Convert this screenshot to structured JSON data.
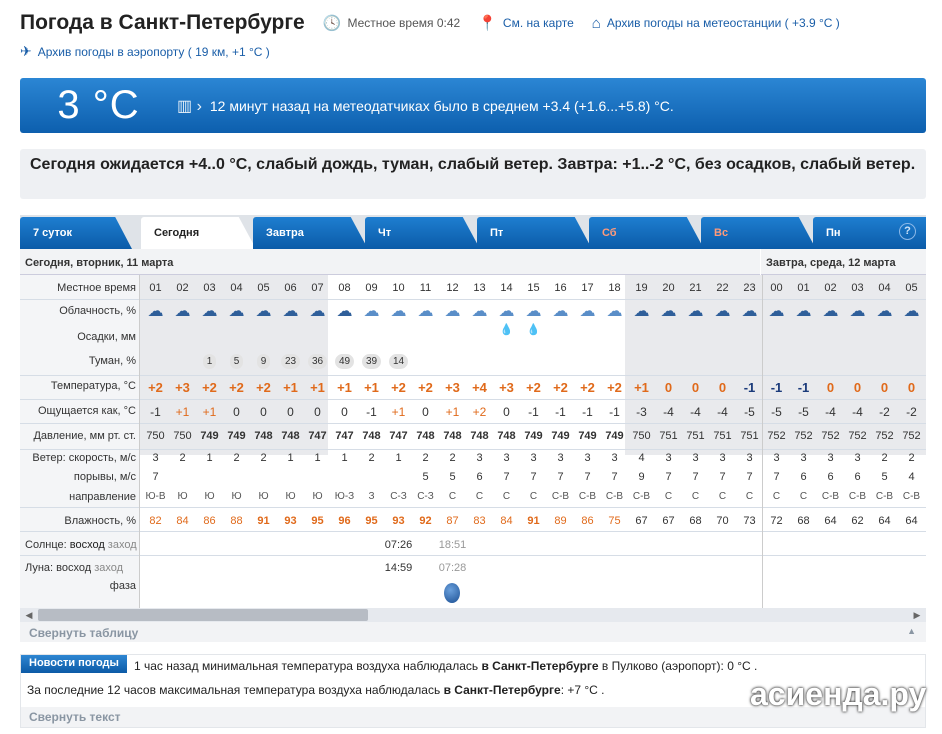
{
  "header": {
    "title": "Погода в Санкт-Петербурге",
    "local_time_label": "Местное время",
    "local_time": "0:42",
    "map_link": "См. на карте",
    "station_link": "Архив погоды на метеостанции",
    "station_temp": "( +3.9 °C )",
    "airport_link": "Архив погоды в аэропорту",
    "airport_info": "( 19 км, +1 °C )"
  },
  "banner": {
    "temp": "3 °C",
    "message": "12 минут назад на метеодатчиках было в среднем +3.4 (+1.6...+5.8) °C."
  },
  "forecast": "Сегодня ожидается +4..0 °C, слабый дождь, туман, слабый ветер. Завтра: +1..-2 °C, без осадков, слабый ветер.",
  "tabs": [
    "7 суток",
    "Сегодня",
    "Завтра",
    "Чт",
    "Пт",
    "Сб",
    "Вс",
    "Пн"
  ],
  "help": "?",
  "days": {
    "today": "Сегодня, вторник, 11 марта",
    "tomorrow": "Завтра, среда, 12 марта"
  },
  "labels": {
    "time": "Местное время",
    "clouds": "Облачность, %",
    "precip": "Осадки, мм",
    "fog": "Туман, %",
    "temp": "Температура, °C",
    "feels": "Ощущается как, °C",
    "pressure": "Давление, мм рт. ст.",
    "wind": "Ветер: скорость, м/с",
    "gusts": "порывы, м/с",
    "dir": "направление",
    "humidity": "Влажность, %",
    "sun_a": "Солнце: ",
    "sun_b": "восход",
    "sun_c": " заход",
    "moon_a": "Луна: ",
    "moon_b": "восход",
    "moon_c": " заход",
    "phase": "фаза"
  },
  "hours": [
    "01",
    "02",
    "03",
    "04",
    "05",
    "06",
    "07",
    "08",
    "09",
    "10",
    "11",
    "12",
    "13",
    "14",
    "15",
    "16",
    "17",
    "18",
    "19",
    "20",
    "21",
    "22",
    "23",
    "00",
    "01",
    "02",
    "03",
    "04",
    "05"
  ],
  "cloud_icons": [
    "☁",
    "☁",
    "☁",
    "☁",
    "☁",
    "☁",
    "☁",
    "☁",
    "☁",
    "☁",
    "☁",
    "☁",
    "☁",
    "☁",
    "☁",
    "☁",
    "☁",
    "☁",
    "☁",
    "☁",
    "☁",
    "☁",
    "☁",
    "☁",
    "☁",
    "☁",
    "☁",
    "☁",
    "☁"
  ],
  "rain_drops": [
    "💧",
    "💧"
  ],
  "fog": [
    "",
    "",
    "1",
    "5",
    "9",
    "23",
    "36",
    "49",
    "39",
    "14",
    "",
    "",
    "",
    "",
    "",
    "",
    "",
    "",
    "",
    "",
    "",
    "",
    "",
    "",
    "",
    "",
    "",
    "",
    ""
  ],
  "temp": [
    "+2",
    "+3",
    "+2",
    "+2",
    "+2",
    "+1",
    "+1",
    "+1",
    "+1",
    "+2",
    "+2",
    "+3",
    "+4",
    "+3",
    "+2",
    "+2",
    "+2",
    "+2",
    "+1",
    "0",
    "0",
    "0",
    "-1",
    "-1",
    "-1",
    "0",
    "0",
    "0",
    "0"
  ],
  "feels": [
    "-1",
    "+1",
    "+1",
    "0",
    "0",
    "0",
    "0",
    "0",
    "-1",
    "+1",
    "0",
    "+1",
    "+2",
    "0",
    "-1",
    "-1",
    "-1",
    "-1",
    "-3",
    "-4",
    "-4",
    "-4",
    "-5",
    "-5",
    "-5",
    "-4",
    "-4",
    "-2",
    "-2"
  ],
  "pressure": [
    "750",
    "750",
    "749",
    "749",
    "748",
    "748",
    "747",
    "747",
    "748",
    "747",
    "748",
    "748",
    "748",
    "748",
    "749",
    "749",
    "749",
    "749",
    "750",
    "751",
    "751",
    "751",
    "751",
    "752",
    "752",
    "752",
    "752",
    "752",
    "752"
  ],
  "wind": [
    "3",
    "2",
    "1",
    "2",
    "2",
    "1",
    "1",
    "1",
    "2",
    "1",
    "2",
    "2",
    "3",
    "3",
    "3",
    "3",
    "3",
    "3",
    "4",
    "3",
    "3",
    "3",
    "3",
    "3",
    "3",
    "3",
    "3",
    "2",
    "2"
  ],
  "gusts": [
    "7",
    "",
    "",
    "",
    "",
    "",
    "",
    "",
    "",
    "",
    "5",
    "5",
    "6",
    "7",
    "7",
    "7",
    "7",
    "7",
    "9",
    "7",
    "7",
    "7",
    "7",
    "7",
    "6",
    "6",
    "6",
    "5",
    "4"
  ],
  "dir": [
    "Ю-В",
    "Ю",
    "Ю",
    "Ю",
    "Ю",
    "Ю",
    "Ю",
    "Ю-З",
    "З",
    "С-З",
    "С-З",
    "С",
    "С",
    "С",
    "С",
    "С-В",
    "С-В",
    "С-В",
    "С-В",
    "С",
    "С",
    "С",
    "С",
    "С",
    "С",
    "С-В",
    "С-В",
    "С-В",
    "С-В"
  ],
  "humidity": [
    "82",
    "84",
    "86",
    "88",
    "91",
    "93",
    "95",
    "96",
    "95",
    "93",
    "92",
    "87",
    "83",
    "84",
    "91",
    "89",
    "86",
    "75",
    "67",
    "67",
    "68",
    "70",
    "73",
    "72",
    "68",
    "64",
    "62",
    "64",
    "64"
  ],
  "sun": {
    "rise": "07:26",
    "set": "18:51"
  },
  "moon": {
    "rise": "14:59",
    "set": "07:28"
  },
  "fold_table": "Свернуть таблицу",
  "news": {
    "badge": "Новости погоды",
    "line1_a": "1 час назад минимальная температура воздуха наблюдалась ",
    "line1_b": "в Санкт-Петербурге",
    "line1_c": " в Пулково (аэропорт): 0 °C .",
    "line2_a": "За последние 12 часов максимальная температура воздуха наблюдалась ",
    "line2_b": "в Санкт-Петербурге",
    "line2_c": ": +7 °C .",
    "fold": "Свернуть текст"
  },
  "watermark": "асиенда.ру",
  "colors": {
    "accent": "#0d5fae",
    "warm": "#e06a1b"
  }
}
